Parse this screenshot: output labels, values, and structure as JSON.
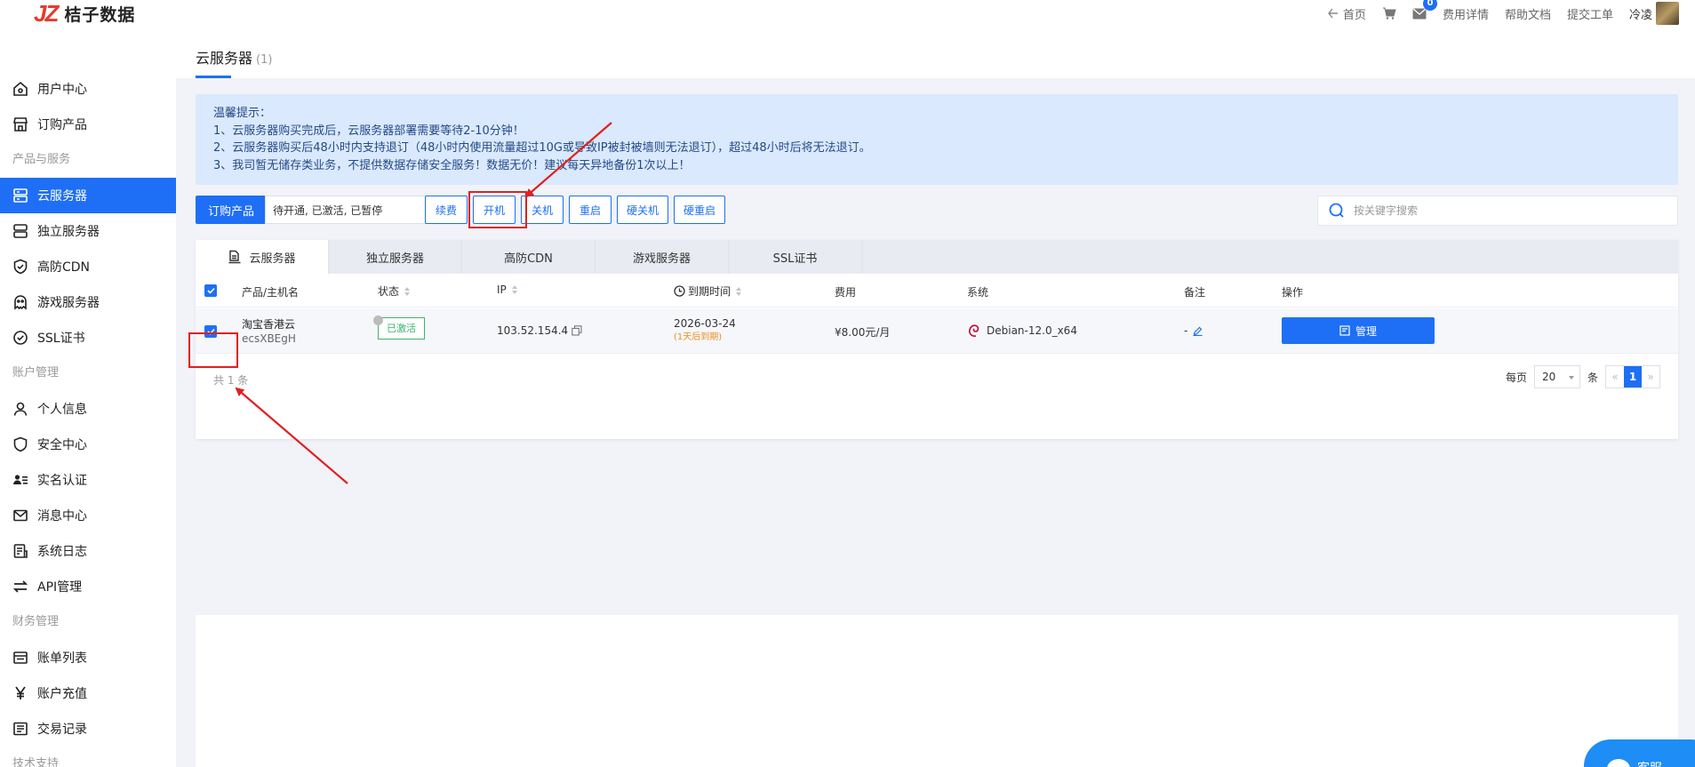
{
  "brand": {
    "logo_mark": "JZ",
    "name": "桔子数据",
    "accent": "#1e6ff5",
    "logo_color": "#e63a2e"
  },
  "topnav": {
    "home": "首页",
    "cart_icon": "cart-icon",
    "mail_badge": "0",
    "billing": "费用详情",
    "help": "帮助文档",
    "ticket": "提交工单",
    "username": "冷凌"
  },
  "sidebar": {
    "items": [
      {
        "label": "用户中心",
        "icon": "home-icon"
      },
      {
        "label": "订购产品",
        "icon": "store-icon"
      },
      {
        "group": "产品与服务"
      },
      {
        "label": "云服务器",
        "icon": "server-icon",
        "active": true
      },
      {
        "label": "独立服务器",
        "icon": "dedicated-server-icon"
      },
      {
        "label": "高防CDN",
        "icon": "shield-check-icon"
      },
      {
        "label": "游戏服务器",
        "icon": "ghost-icon"
      },
      {
        "label": "SSL证书",
        "icon": "check-circle-icon"
      },
      {
        "group": "账户管理"
      },
      {
        "label": "个人信息",
        "icon": "user-icon"
      },
      {
        "label": "安全中心",
        "icon": "shield-icon"
      },
      {
        "label": "实名认证",
        "icon": "id-card-icon"
      },
      {
        "label": "消息中心",
        "icon": "mail-icon"
      },
      {
        "label": "系统日志",
        "icon": "log-icon"
      },
      {
        "label": "API管理",
        "icon": "swap-icon"
      },
      {
        "group": "财务管理"
      },
      {
        "label": "账单列表",
        "icon": "bill-icon"
      },
      {
        "label": "账户充值",
        "icon": "yen-icon"
      },
      {
        "label": "交易记录",
        "icon": "record-icon"
      },
      {
        "group": "技术支持"
      }
    ]
  },
  "page": {
    "title": "云服务器",
    "count": "(1)"
  },
  "notice": {
    "lines": [
      "温馨提示：",
      "1、云服务器购买完成后，云服务器部署需要等待2-10分钟！",
      "2、云服务器购买后48小时内支持退订（48小时内使用流量超过10G或导致IP被封被墙则无法退订），超过48小时后将无法退订。",
      "3、我司暂无储存类业务，不提供数据存储安全服务！数据无价！建议每天异地备份1次以上！"
    ]
  },
  "toolbar": {
    "order_label": "订购产品",
    "filter_value": "待开通, 已激活, 已暂停",
    "buttons": [
      "续费",
      "开机",
      "关机",
      "重启",
      "硬关机",
      "硬重启"
    ],
    "search_placeholder": "按关键字搜索"
  },
  "tabs": [
    "云服务器",
    "独立服务器",
    "高防CDN",
    "游戏服务器",
    "SSL证书"
  ],
  "table": {
    "headers": {
      "product": "产品/主机名",
      "status": "状态",
      "ip": "IP",
      "expire": "到期时间",
      "fee": "费用",
      "os": "系统",
      "remark": "备注",
      "action": "操作"
    },
    "rows": [
      {
        "product": "淘宝香港云",
        "hostname": "ecsXBEgH",
        "status": "已激活",
        "ip": "103.52.154.4",
        "expire_date": "2026-03-24",
        "expire_note": "(1天后到期)",
        "fee": "¥8.00元/月",
        "os": "Debian-12.0_x64",
        "remark": "-",
        "action": "管理"
      }
    ]
  },
  "pagination": {
    "total": "共 1 条",
    "per_page_label": "每页",
    "per_page": "20",
    "unit": "条",
    "prev": "«",
    "current": "1",
    "next": "»"
  },
  "support_button": "客服"
}
